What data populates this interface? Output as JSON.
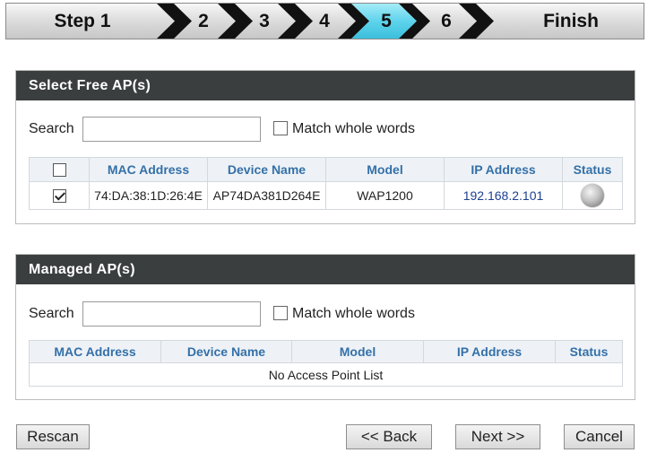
{
  "wizard": {
    "steps": [
      "Step 1",
      "2",
      "3",
      "4",
      "5",
      "6",
      "Finish"
    ],
    "active_step": "5",
    "colors": {
      "bar": "#d6d6d6",
      "chevron": "#111111",
      "active": "#5ed3ec"
    }
  },
  "free_aps": {
    "title": "Select Free AP(s)",
    "search_label": "Search",
    "search_value": "",
    "match_label": "Match whole words",
    "match_checked": false,
    "columns": [
      "MAC Address",
      "Device Name",
      "Model",
      "IP Address",
      "Status"
    ],
    "rows": [
      {
        "checked": true,
        "mac": "74:DA:38:1D:26:4E",
        "device_name": "AP74DA381D264E",
        "model": "WAP1200",
        "ip": "192.168.2.101",
        "status_icon": "status-grey-dot-icon"
      }
    ]
  },
  "managed_aps": {
    "title": "Managed AP(s)",
    "search_label": "Search",
    "search_value": "",
    "match_label": "Match whole words",
    "match_checked": false,
    "columns": [
      "MAC Address",
      "Device Name",
      "Model",
      "IP Address",
      "Status"
    ],
    "empty_text": "No Access Point List"
  },
  "buttons": {
    "rescan": "Rescan",
    "back": "<< Back",
    "next": "Next >>",
    "cancel": "Cancel"
  }
}
